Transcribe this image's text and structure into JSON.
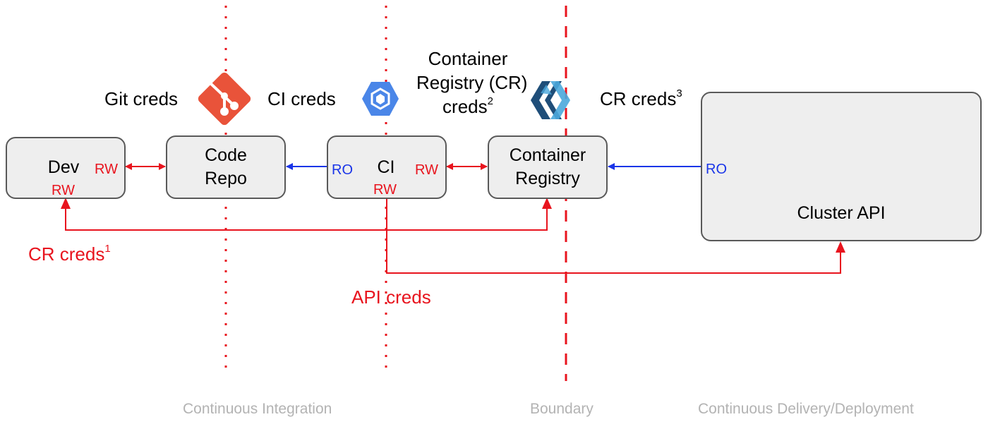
{
  "colors": {
    "rw_red": "#e8141e",
    "ro_blue": "#1a35e8",
    "node_fill": "#eeeeee",
    "node_border": "#595959",
    "zone_gray": "#b3b3b3",
    "git_orange": "#e9533a",
    "gcp_blue": "#4a86e8",
    "harbor_dark": "#1f4e79",
    "harbor_light": "#4aa8dc"
  },
  "nodes": {
    "dev": {
      "label": "Dev",
      "badge_right": "RW",
      "badge_bottom": "RW"
    },
    "code_repo": {
      "label": "Code\nRepo"
    },
    "ci": {
      "label": "CI",
      "badge_left": "RO",
      "badge_right": "RW",
      "badge_bottom": "RW"
    },
    "container_registry": {
      "label": "Container\nRegistry"
    },
    "cluster_api": {
      "label": "Cluster API",
      "badge_left": "RO"
    }
  },
  "credentials": {
    "git": {
      "text": "Git creds"
    },
    "ci": {
      "text": "CI creds"
    },
    "cr": {
      "line1": "Container",
      "line2": "Registry (CR)",
      "line3": "creds",
      "sup": "2"
    },
    "cr3": {
      "text": "CR creds",
      "sup": "3"
    },
    "cr1": {
      "text": "CR creds",
      "sup": "1"
    },
    "api": {
      "text": "API creds"
    }
  },
  "icons": {
    "git": "git-logo-icon",
    "gcp": "google-cloud-build-icon",
    "harbor": "container-registry-logo-icon"
  },
  "zones": {
    "ci": "Continuous Integration",
    "boundary": "Boundary",
    "cd": "Continuous Delivery/Deployment"
  },
  "edges": [
    {
      "from": "dev",
      "to": "code_repo",
      "type": "bidirectional",
      "access": "RW",
      "color": "#e8141e"
    },
    {
      "from": "ci",
      "to": "code_repo",
      "type": "directed",
      "access": "RO",
      "color": "#1a35e8"
    },
    {
      "from": "ci",
      "to": "container_registry",
      "type": "bidirectional",
      "access": "RW",
      "color": "#e8141e"
    },
    {
      "from": "cluster_api",
      "to": "container_registry",
      "type": "directed",
      "access": "RO",
      "color": "#1a35e8"
    },
    {
      "from": "dev",
      "to": "container_registry",
      "type": "shared-line",
      "label": "CR creds 1",
      "color": "#e8141e"
    },
    {
      "from": "ci",
      "to": "cluster_api",
      "type": "directed",
      "label": "API creds",
      "color": "#e8141e"
    }
  ]
}
